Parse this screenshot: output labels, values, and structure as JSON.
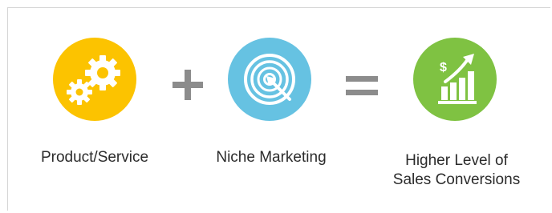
{
  "colors": {
    "gear_circle": "#fcc300",
    "target_circle": "#66c2e2",
    "growth_circle": "#7fc242",
    "operator": "#8c8c8c",
    "text": "#2b2b2b",
    "frame_border": "#d6d6d6"
  },
  "items": [
    {
      "icon": "gears-icon",
      "label": "Product/Service"
    },
    {
      "icon": "target-icon",
      "label": "Niche Marketing"
    },
    {
      "icon": "growth-chart-icon",
      "label_line1": "Higher Level of",
      "label_line2": "Sales Conversions",
      "symbol": "$"
    }
  ],
  "operators": [
    "plus-icon",
    "equals-icon"
  ]
}
